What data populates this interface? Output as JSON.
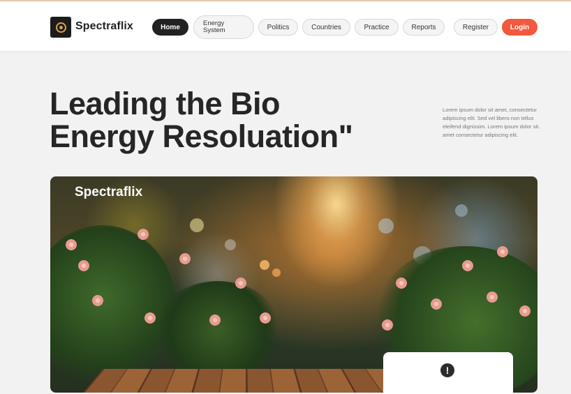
{
  "brand": {
    "name": "Spectraflix",
    "logo_icon": "spectraflix-logo-icon"
  },
  "nav": {
    "items": [
      {
        "label": "Home",
        "active": true
      },
      {
        "label": "Energy\nSystem",
        "active": false
      },
      {
        "label": "Politics",
        "active": false
      },
      {
        "label": "Countries",
        "active": false
      },
      {
        "label": "Practice",
        "active": false
      },
      {
        "label": "Reports",
        "active": false
      }
    ],
    "register": "Register",
    "login": "Login"
  },
  "hero": {
    "title_line1": "Leading the Bio",
    "title_line2": "Energy Resoluation\"",
    "description": "Lorem ipsum dolor sit amet, consectetur adipiscing elit. Sed vel libero non tellus eleifend dignissim. Lorem ipsum dolor sit. amet consectetur adipiscing elit."
  },
  "banner": {
    "brand_label": "Spectraflix"
  },
  "card": {
    "icon": "alert-icon",
    "icon_glyph": "!"
  },
  "colors": {
    "accent": "#f2583e",
    "dark": "#222222",
    "background": "#f2f2f2"
  }
}
